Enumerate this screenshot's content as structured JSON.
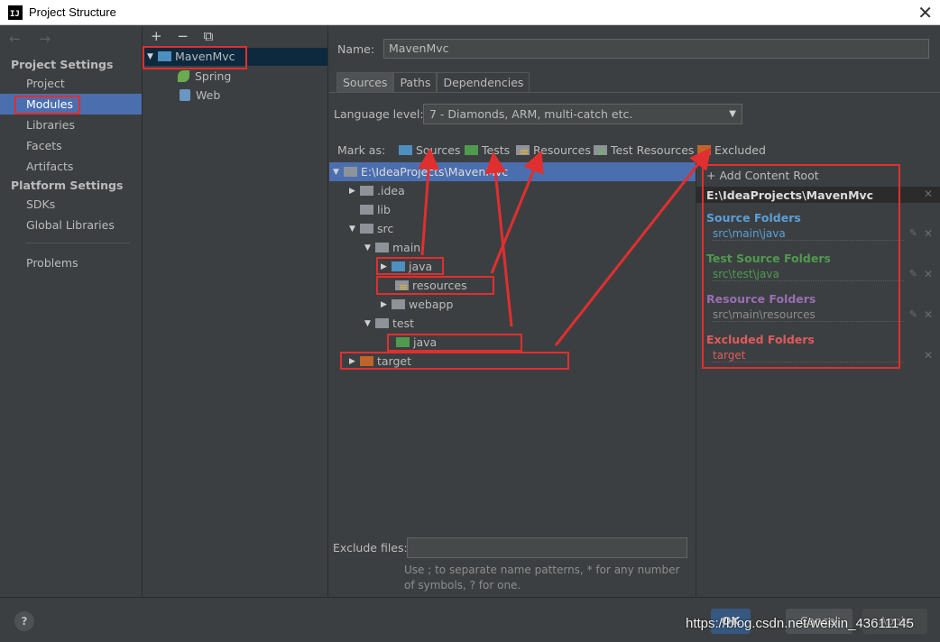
{
  "window": {
    "title": "Project Structure",
    "app_icon_text": "IJ"
  },
  "leftnav": {
    "arrows": "← →",
    "project_settings_header": "Project Settings",
    "project_settings": [
      "Project",
      "Modules",
      "Libraries",
      "Facets",
      "Artifacts"
    ],
    "platform_settings_header": "Platform Settings",
    "platform_settings": [
      "SDKs",
      "Global Libraries"
    ],
    "problems": "Problems",
    "selected": "Modules"
  },
  "moduletree": {
    "toolbar": "+ − ⧉",
    "module": "MavenMvc",
    "facets": [
      "Spring",
      "Web"
    ]
  },
  "main": {
    "name_label": "Name:",
    "name_value": "MavenMvc",
    "tabs": [
      "Sources",
      "Paths",
      "Dependencies"
    ],
    "active_tab": "Sources",
    "language_level_label": "Language level:",
    "language_level_value": "7 - Diamonds, ARM, multi-catch etc.",
    "mark_as_label": "Mark as:",
    "mark_buttons": [
      "Sources",
      "Tests",
      "Resources",
      "Test Resources",
      "Excluded"
    ],
    "tree": {
      "root": "E:\\IdeaProjects\\MavenMvc",
      "idea": ".idea",
      "lib": "lib",
      "src": "src",
      "main": "main",
      "main_java": "java",
      "resources": "resources",
      "webapp": "webapp",
      "test": "test",
      "test_java": "java",
      "target": "target"
    },
    "exclude_files_label": "Exclude files:",
    "exclude_hint": "Use ; to separate name patterns, * for any number of symbols, ? for one."
  },
  "roots": {
    "add_content_root": "+ Add Content Root",
    "content_root": "E:\\IdeaProjects\\MavenMvc",
    "source_folders_header": "Source Folders",
    "source_folder": "src\\main\\java",
    "test_source_folders_header": "Test Source Folders",
    "test_source_folder": "src\\test\\java",
    "resource_folders_header": "Resource Folders",
    "resource_folder": "src\\main\\resources",
    "excluded_folders_header": "Excluded Folders",
    "excluded_folder": "target"
  },
  "buttons": {
    "help": "?",
    "ok": "OK",
    "cancel": "Cancel",
    "apply": "Apply"
  },
  "watermark": "https://blog.csdn.net/weixin_43611145",
  "colors": {
    "selection": "#4b6eaf",
    "source": "#5a9fd8",
    "test": "#4f9a4f",
    "resource": "#9a6db3",
    "excluded": "#e05b5b",
    "annotation": "#e02f2f"
  }
}
